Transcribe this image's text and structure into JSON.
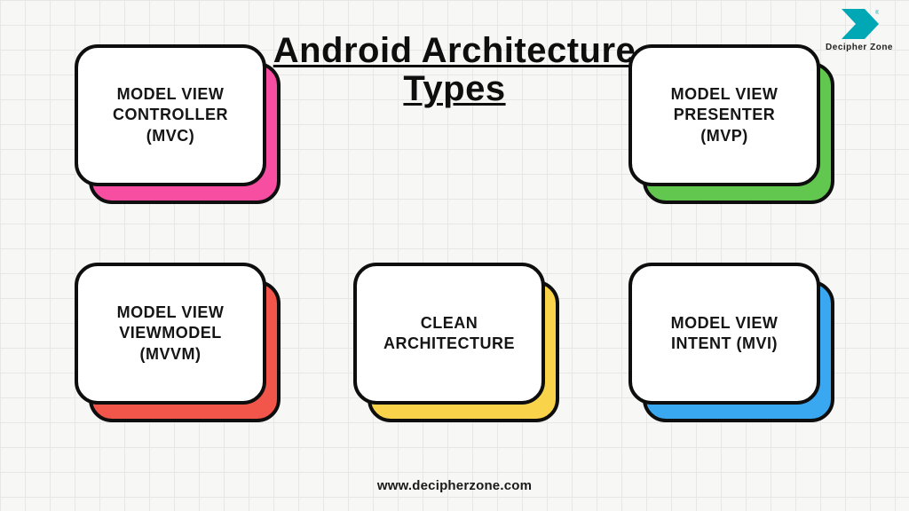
{
  "title": "Android\nArchitecture\nTypes",
  "logo": {
    "brand": "Decipher Zone",
    "color": "#00a8b5"
  },
  "cards": {
    "mvc": {
      "label": "MODEL VIEW\nCONTROLLER\n(MVC)",
      "accent": "#f74ea1"
    },
    "mvp": {
      "label": "MODEL VIEW\nPRESENTER\n(MVP)",
      "accent": "#61c74f"
    },
    "mvvm": {
      "label": "MODEL VIEW\nVIEWMODEL\n(MVVM)",
      "accent": "#f2564a"
    },
    "clean": {
      "label": "CLEAN\nARCHITECTURE",
      "accent": "#f9d44b"
    },
    "mvi": {
      "label": "MODEL VIEW\nINTENT (MVI)",
      "accent": "#3aa8f0"
    }
  },
  "footer_url": "www.decipherzone.com",
  "chart_data": {
    "type": "table",
    "title": "Android Architecture Types",
    "categories": [
      "Model View Controller (MVC)",
      "Model View Presenter (MVP)",
      "Model View ViewModel (MVVM)",
      "Clean Architecture",
      "Model View Intent (MVI)"
    ]
  }
}
